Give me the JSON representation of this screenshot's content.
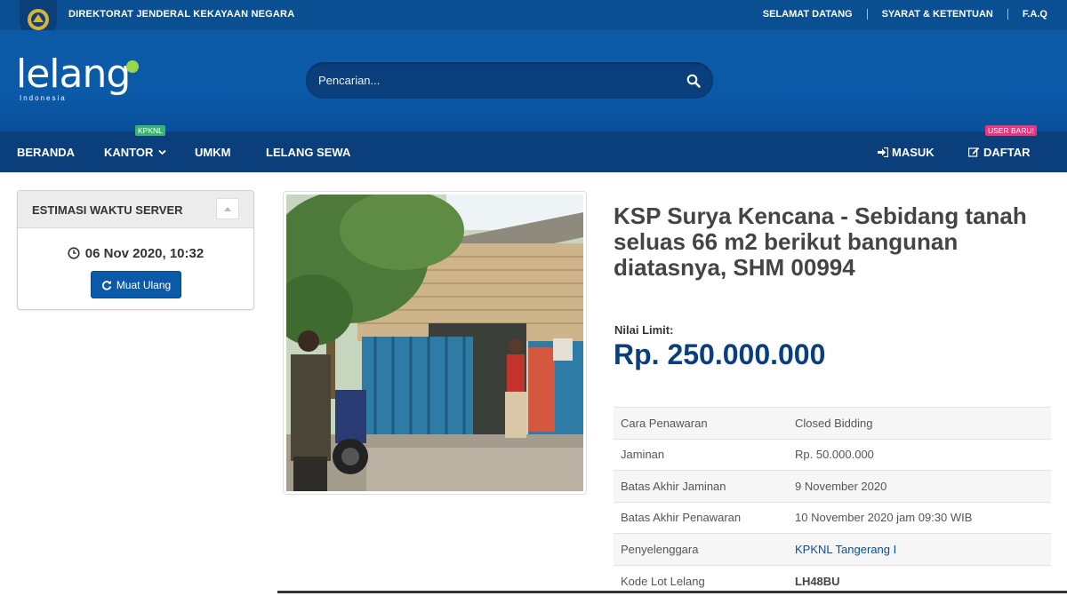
{
  "topbar": {
    "org_name": "DIREKTORAT JENDERAL KEKAYAAN NEGARA",
    "links": [
      "SELAMAT DATANG",
      "SYARAT & KETENTUAN",
      "F.A.Q"
    ]
  },
  "header": {
    "logo_text": "lelang",
    "logo_sub": "Indonesia",
    "search_placeholder": "Pencarian..."
  },
  "nav": {
    "items": [
      "BERANDA",
      "KANTOR",
      "UMKM",
      "LELANG SEWA"
    ],
    "kantor_badge": "KPKNL",
    "login": "MASUK",
    "register": "DAFTAR",
    "register_badge": "USER BARU!"
  },
  "server_panel": {
    "title": "ESTIMASI WAKTU SERVER",
    "time": "06 Nov 2020, 10:32",
    "reload_label": "Muat Ulang"
  },
  "lot": {
    "title": "KSP Surya Kencana - Sebidang tanah seluas 66 m2 berikut bangunan diatasnya, SHM 00994",
    "limit_label": "Nilai Limit:",
    "limit_value": "Rp. 250.000.000",
    "details": [
      {
        "label": "Cara Penawaran",
        "value": "Closed Bidding"
      },
      {
        "label": "Jaminan",
        "value": "Rp. 50.000.000"
      },
      {
        "label": "Batas Akhir Jaminan",
        "value": "9 November 2020"
      },
      {
        "label": "Batas Akhir Penawaran",
        "value": "10 November 2020 jam 09:30 WIB"
      },
      {
        "label": "Penyelenggara",
        "value": "KPKNL Tangerang I"
      },
      {
        "label": "Kode Lot Lelang",
        "value": "LH48BU"
      }
    ]
  },
  "colors": {
    "topbar": "#0b4f93",
    "header": "#0b5aa9",
    "nav": "#0a3f7c",
    "accent_green": "#9bd64a",
    "badge_green": "#3cb371",
    "badge_pink": "#e8367a"
  }
}
